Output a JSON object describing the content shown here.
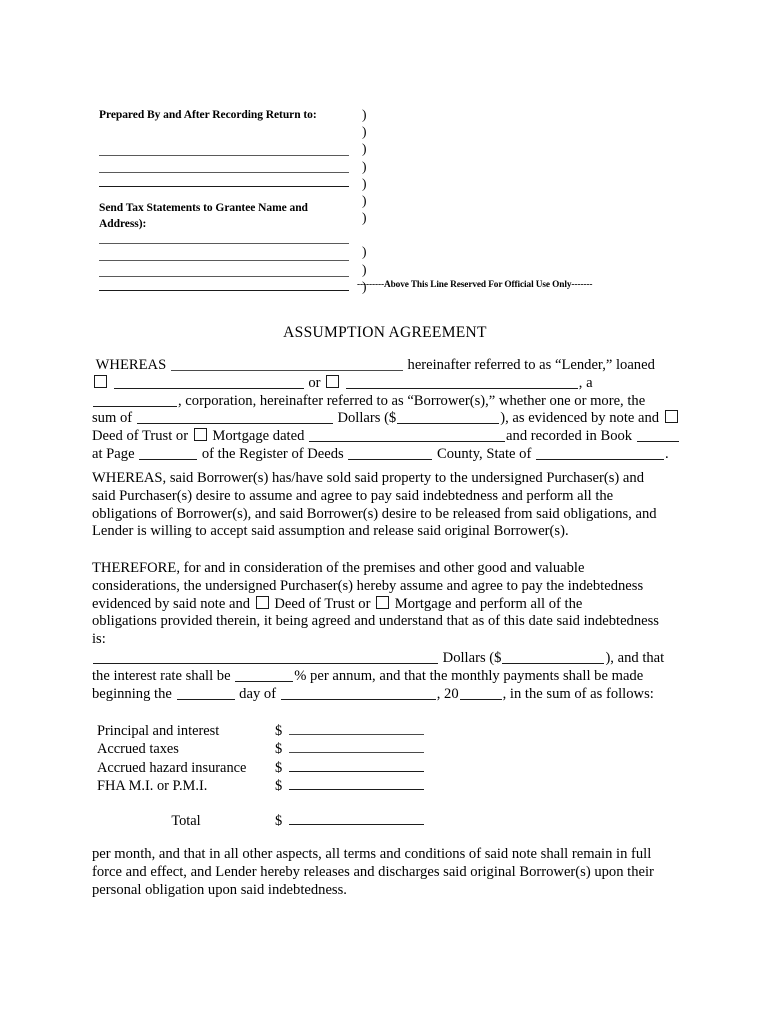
{
  "document": {
    "title": "ASSUMPTION AGREEMENT"
  },
  "recording_header": {
    "prepared_by_label": "Prepared By and After Recording Return to:",
    "send_tax_label_line1": "Send Tax Statements to Grantee Name and",
    "send_tax_label_line2": "Address):",
    "paren_mark": ")",
    "paren_count": 11,
    "official_use_note": "---------Above This Line Reserved For Official Use Only-------",
    "blank_lines_group1": 3,
    "blank_lines_group2": 4
  },
  "whereas_clause": {
    "t1": "WHEREAS",
    "t2": "hereinafter referred to as “Lender,” loaned",
    "t3": "or",
    "t4": ", a",
    "t5": ", corporation, hereinafter referred to as “Borrower(s),” whether one or more, the",
    "t6": "sum of",
    "t7": "Dollars ($",
    "t8": "), as evidenced by note and",
    "t9": "Deed of Trust or",
    "t10": "Mortgage dated",
    "t11": "and recorded in Book",
    "t12": "at Page",
    "t13": "of the Register of Deeds",
    "t14": "County, State of",
    "t15": "."
  },
  "whereas_sold": {
    "line1": "WHEREAS, said Borrower(s) has/have sold said property to the undersigned Purchaser(s) and",
    "line2": "said Purchaser(s) desire to assume and agree to pay said indebtedness and perform all the",
    "line3": "obligations of Borrower(s), and said Borrower(s) desire to be released from said obligations, and",
    "line4": "Lender is willing to accept said assumption and release said original Borrower(s)."
  },
  "therefore_clause": {
    "line1": "THEREFORE, for and in consideration of the premises and other good and valuable",
    "line2": "considerations, the undersigned Purchaser(s) hereby assume and agree to pay the indebtedness",
    "line3a": "evidenced by said note and",
    "line3b": "Deed of Trust or",
    "line3c": "Mortgage and perform all of the",
    "line4": "obligations provided therein, it being agreed and understand that as of this date said indebtedness",
    "line5": "is:"
  },
  "amount_terms": {
    "t1": "Dollars ($",
    "t2": "), and that",
    "t3": "the interest rate shall be",
    "t4": "% per annum, and that the monthly payments shall be made",
    "t5": "beginning the",
    "t6": "day of",
    "t7": ", 20",
    "t8": ", in the sum of as follows:"
  },
  "payment_schedule": {
    "currency_symbol": "$",
    "rows": [
      {
        "label": "Principal and interest"
      },
      {
        "label": "Accrued taxes"
      },
      {
        "label": "Accrued hazard insurance"
      },
      {
        "label": "FHA M.I. or P.M.I."
      }
    ],
    "total_label": "Total"
  },
  "closing": {
    "line1": "per month, and that in all other aspects, all terms and conditions of said note shall remain in full",
    "line2": "force and effect, and Lender hereby releases and discharges said original Borrower(s) upon their",
    "line3": "personal obligation upon said indebtedness."
  }
}
